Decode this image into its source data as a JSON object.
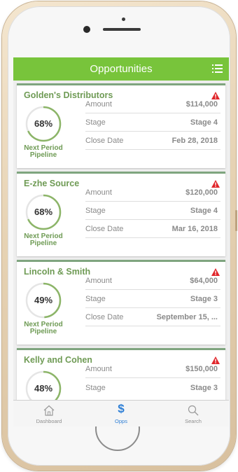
{
  "app": {
    "title": "Opportunities",
    "accent_color": "#78c43b",
    "link_color": "#2e7fd6",
    "warning_color": "#e0262b"
  },
  "opportunities": [
    {
      "name": "Golden's Distributors",
      "percent_label": "68%",
      "percent": 68,
      "ring_label_line1": "Next Period",
      "ring_label_line2": "Pipeline",
      "amount_label": "Amount",
      "amount": "$114,000",
      "stage_label": "Stage",
      "stage": "Stage 4",
      "close_label": "Close Date",
      "close_date": "Feb 28, 2018",
      "icon": "warning-icon"
    },
    {
      "name": "E-zhe Source",
      "percent_label": "68%",
      "percent": 68,
      "ring_label_line1": "Next Period",
      "ring_label_line2": "Pipeline",
      "amount_label": "Amount",
      "amount": "$120,000",
      "stage_label": "Stage",
      "stage": "Stage 4",
      "close_label": "Close Date",
      "close_date": "Mar 16, 2018",
      "icon": "warning-icon"
    },
    {
      "name": "Lincoln & Smith",
      "percent_label": "49%",
      "percent": 49,
      "ring_label_line1": "Next Period",
      "ring_label_line2": "Pipeline",
      "amount_label": "Amount",
      "amount": "$64,000",
      "stage_label": "Stage",
      "stage": "Stage 3",
      "close_label": "Close Date",
      "close_date": "September 15, ...",
      "icon": "warning-icon"
    },
    {
      "name": "Kelly and Cohen",
      "percent_label": "48%",
      "percent": 48,
      "amount_label": "Amount",
      "amount": "$150,000",
      "stage_label": "Stage",
      "stage": "Stage 3",
      "icon": "warning-icon"
    }
  ],
  "tabbar": {
    "items": [
      {
        "label": "Dashboard",
        "icon": "home-icon",
        "active": false
      },
      {
        "label": "Opps",
        "icon": "dollar-icon",
        "glyph": "$",
        "active": true
      },
      {
        "label": "Search",
        "icon": "search-icon",
        "active": false
      }
    ]
  }
}
